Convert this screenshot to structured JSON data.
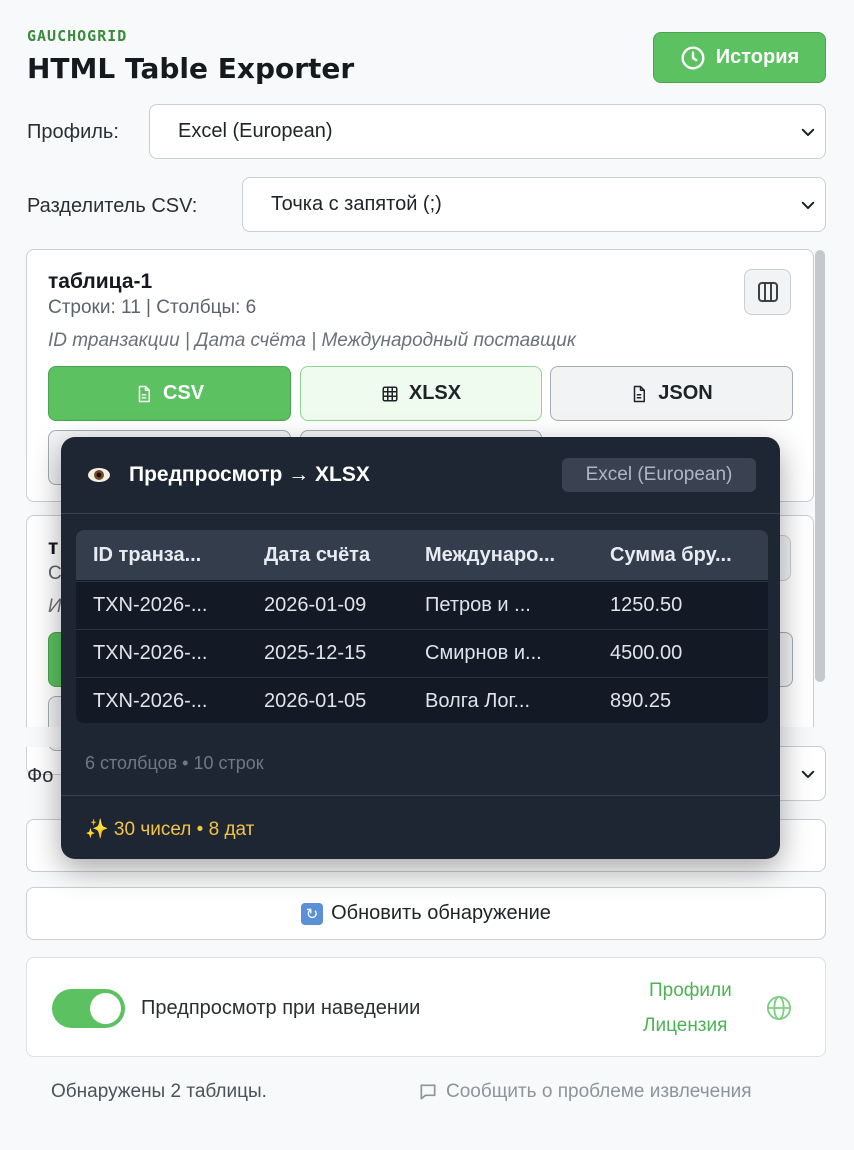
{
  "header": {
    "brand": "GAUCHOGRID",
    "title": "HTML Table Exporter",
    "history_label": "История"
  },
  "profile": {
    "label": "Профиль:",
    "value": "Excel (European)"
  },
  "delimiter": {
    "label": "Разделитель CSV:",
    "value": "Точка с запятой (;)"
  },
  "tables": [
    {
      "name": "таблица-1",
      "meta": "Строки: 11 | Столбцы: 6",
      "columns": "ID транзакции | Дата счёта | Международный поставщик",
      "buttons": {
        "csv": "CSV",
        "xlsx": "XLSX",
        "json": "JSON"
      }
    },
    {
      "name": "т",
      "meta": "С",
      "columns": "И"
    }
  ],
  "format_row": {
    "label_partial": "Фо"
  },
  "refresh_label": "Обновить обнаружение",
  "settings": {
    "hover_preview_label": "Предпросмотр при наведении",
    "hover_preview_on": true,
    "link_profiles": "Профили",
    "link_license": "Лицензия"
  },
  "footer": {
    "status": "Обнаружены 2 таблицы.",
    "report": "Сообщить о проблеме извлечения"
  },
  "preview": {
    "title": "Предпросмотр → XLSX",
    "profile_badge": "Excel (European)",
    "columns": [
      "ID транза...",
      "Дата счёта",
      "Междунаро...",
      "Сумма бру..."
    ],
    "rows": [
      [
        "TXN-2026-...",
        "2026-01-09",
        "Петров и ...",
        "1250.50"
      ],
      [
        "TXN-2026-...",
        "2025-12-15",
        "Смирнов и...",
        "4500.00"
      ],
      [
        "TXN-2026-...",
        "2026-01-05",
        "Волга Лог...",
        "890.25"
      ]
    ],
    "summary": "6 столбцов • 10 строк",
    "detected": "✨ 30 чисел • 8 дат"
  },
  "colors": {
    "accent": "#5cc160",
    "brand": "#3a8a3f",
    "popover_bg": "#1f2633",
    "highlight": "#f0c445"
  }
}
